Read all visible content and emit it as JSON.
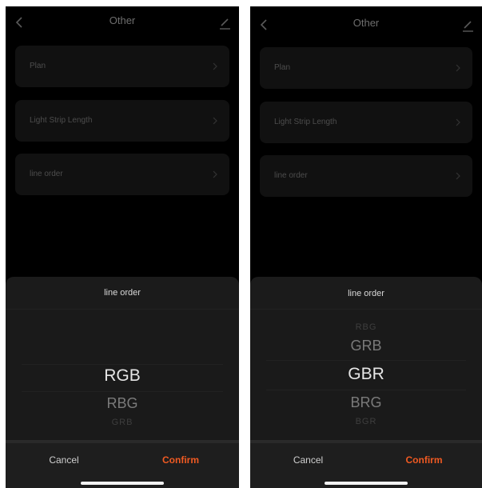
{
  "colors": {
    "accent": "#f05a22",
    "background": "#000000",
    "sheet": "#1b1b1b"
  },
  "screens": [
    {
      "header": {
        "title": "Other",
        "back_icon": "chevron-left-icon",
        "edit_icon": "edit-pen-icon"
      },
      "settings": [
        {
          "label": "Plan"
        },
        {
          "label": "Light Strip Length"
        },
        {
          "label": "line order"
        }
      ],
      "sheet": {
        "title": "line order",
        "options": [
          "RGB",
          "RBG",
          "GRB"
        ],
        "selected": "RGB",
        "cancel_label": "Cancel",
        "confirm_label": "Confirm"
      }
    },
    {
      "header": {
        "title": "Other",
        "back_icon": "chevron-left-icon",
        "edit_icon": "edit-pen-icon"
      },
      "settings": [
        {
          "label": "Plan"
        },
        {
          "label": "Light Strip Length"
        },
        {
          "label": "line order"
        }
      ],
      "sheet": {
        "title": "line order",
        "options": [
          "RBG",
          "GRB",
          "GBR",
          "BRG",
          "BGR"
        ],
        "selected": "GBR",
        "cancel_label": "Cancel",
        "confirm_label": "Confirm"
      }
    }
  ]
}
